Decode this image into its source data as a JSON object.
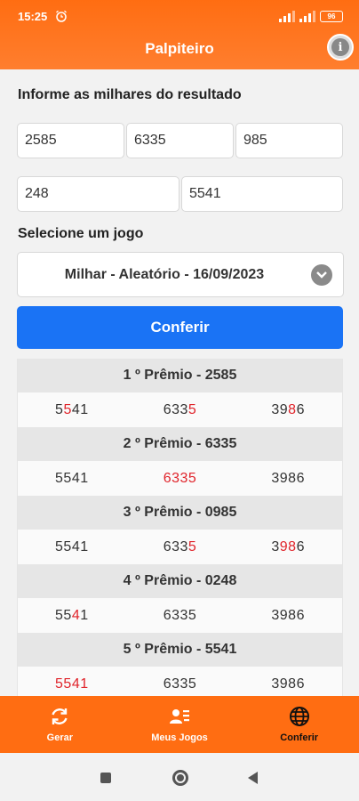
{
  "status": {
    "time": "15:25",
    "battery": "96"
  },
  "app": {
    "title": "Palpiteiro"
  },
  "form": {
    "results_title": "Informe as milhares do resultado",
    "inputs": [
      "2585",
      "6335",
      "985",
      "248",
      "5541"
    ],
    "game_title": "Selecione um jogo",
    "game_selected": "Milhar - Aleatório - 16/09/2023",
    "check_label": "Conferir"
  },
  "prizes": [
    {
      "title": "1 º Prêmio - 2585",
      "numbers": [
        [
          {
            "t": "5",
            "h": false
          },
          {
            "t": "5",
            "h": true
          },
          {
            "t": "41",
            "h": false
          }
        ],
        [
          {
            "t": "633",
            "h": false
          },
          {
            "t": "5",
            "h": true
          }
        ],
        [
          {
            "t": "39",
            "h": false
          },
          {
            "t": "8",
            "h": true
          },
          {
            "t": "6",
            "h": false
          }
        ]
      ]
    },
    {
      "title": "2 º Prêmio - 6335",
      "numbers": [
        [
          {
            "t": "5541",
            "h": false
          }
        ],
        [
          {
            "t": "6335",
            "h": true
          }
        ],
        [
          {
            "t": "3986",
            "h": false
          }
        ]
      ]
    },
    {
      "title": "3 º Prêmio - 0985",
      "numbers": [
        [
          {
            "t": "5541",
            "h": false
          }
        ],
        [
          {
            "t": "633",
            "h": false
          },
          {
            "t": "5",
            "h": true
          }
        ],
        [
          {
            "t": "3",
            "h": false
          },
          {
            "t": "98",
            "h": true
          },
          {
            "t": "6",
            "h": false
          }
        ]
      ]
    },
    {
      "title": "4 º Prêmio - 0248",
      "numbers": [
        [
          {
            "t": "55",
            "h": false
          },
          {
            "t": "4",
            "h": true
          },
          {
            "t": "1",
            "h": false
          }
        ],
        [
          {
            "t": "6335",
            "h": false
          }
        ],
        [
          {
            "t": "3986",
            "h": false
          }
        ]
      ]
    },
    {
      "title": "5 º Prêmio - 5541",
      "numbers": [
        [
          {
            "t": "5541",
            "h": true
          }
        ],
        [
          {
            "t": "6335",
            "h": false
          }
        ],
        [
          {
            "t": "3986",
            "h": false
          }
        ]
      ]
    }
  ],
  "nav": [
    {
      "label": "Gerar",
      "icon": "refresh-icon",
      "active": false
    },
    {
      "label": "Meus Jogos",
      "icon": "contacts-list-icon",
      "active": false
    },
    {
      "label": "Conferir",
      "icon": "globe-icon",
      "active": true
    }
  ],
  "colors": {
    "header": "#ff6d12",
    "button": "#1a73f5",
    "hit": "#e0242b"
  }
}
